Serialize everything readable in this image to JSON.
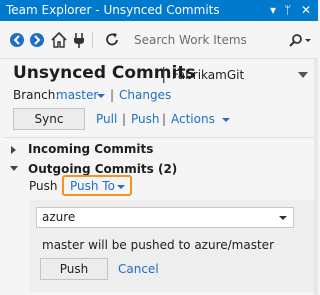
{
  "window": {
    "title": "Team Explorer - Unsynced Commits",
    "dropdown_glyph": "▾",
    "pin_glyph": "ᛘ",
    "close_glyph": "✕"
  },
  "toolbar": {
    "search_placeholder": "Search Work Items",
    "icons": [
      "back-icon",
      "forward-icon",
      "home-icon",
      "connect-icon",
      "refresh-icon",
      "search-icon"
    ]
  },
  "page": {
    "title": "Unsynced Commits",
    "separator": "|",
    "repo": "FabrikamGit"
  },
  "branch": {
    "label": "Branch:",
    "name": "master",
    "changes_link": "Changes"
  },
  "actions": {
    "sync_label": "Sync",
    "pull_label": "Pull",
    "push_label": "Push",
    "actions_label": "Actions"
  },
  "incoming": {
    "title": "Incoming Commits"
  },
  "outgoing": {
    "title": "Outgoing Commits (2)",
    "push_label": "Push",
    "push_to_label": "Push To"
  },
  "push_panel": {
    "remote_selected": "azure",
    "message": "master will be pushed to azure/master",
    "push_button": "Push",
    "cancel_link": "Cancel"
  },
  "colors": {
    "titlebar": "#007acc",
    "link": "#1e6fc5",
    "highlight": "#f7931e"
  }
}
